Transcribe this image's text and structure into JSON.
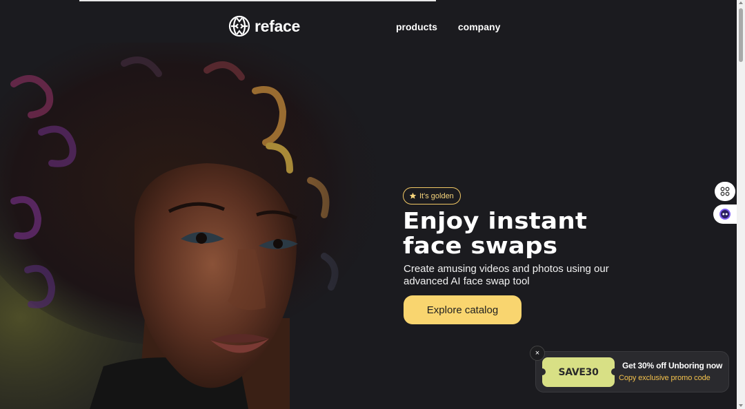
{
  "brand": {
    "name": "reface"
  },
  "nav": {
    "products": "products",
    "company": "company"
  },
  "hero": {
    "badge": "It's golden",
    "headline_line1": "Enjoy instant",
    "headline_line2": "face swaps",
    "subtext_line1": "Create amusing videos and photos using our",
    "subtext_line2": "advanced AI face swap tool",
    "cta": "Explore catalog"
  },
  "promo": {
    "close": "×",
    "code": "SAVE30",
    "title": "Get 30% off Unboring now",
    "subtitle": "Copy exclusive promo code"
  },
  "colors": {
    "background": "#1b1b1f",
    "accent_yellow": "#f9d56f",
    "coupon_green": "#d8e085",
    "promo_orange": "#f4c24d"
  },
  "icons": {
    "logo": "reface-logo-icon",
    "badge": "star-icon",
    "side1": "apps-grid-icon",
    "side2": "assistant-face-icon"
  }
}
